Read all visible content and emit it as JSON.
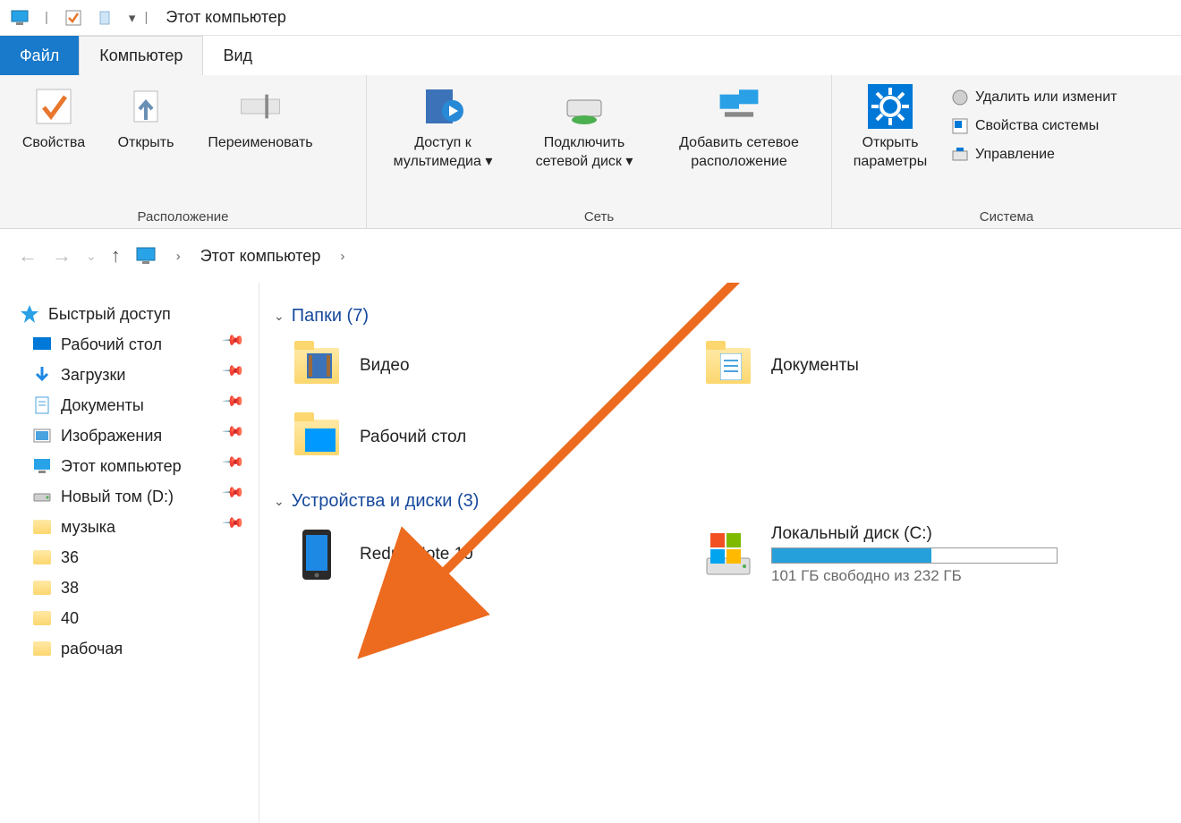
{
  "titlebar": {
    "title": "Этот компьютер"
  },
  "tabs": {
    "file": "Файл",
    "computer": "Компьютер",
    "view": "Вид"
  },
  "ribbon": {
    "group_location": {
      "label": "Расположение",
      "properties": "Свойства",
      "open": "Открыть",
      "rename": "Переименовать"
    },
    "group_network": {
      "label": "Сеть",
      "media_access": "Доступ к мультимедиа ▾",
      "map_drive": "Подключить сетевой диск ▾",
      "add_location": "Добавить сетевое расположение"
    },
    "group_system": {
      "label": "Система",
      "open_settings": "Открыть параметры",
      "uninstall": "Удалить или изменит",
      "sys_props": "Свойства системы",
      "manage": "Управление"
    }
  },
  "breadcrumb": {
    "segment": "Этот компьютер"
  },
  "sidebar": {
    "quick_access": "Быстрый доступ",
    "items": [
      {
        "label": "Рабочий стол",
        "icon": "desktop"
      },
      {
        "label": "Загрузки",
        "icon": "downloads"
      },
      {
        "label": "Документы",
        "icon": "documents"
      },
      {
        "label": "Изображения",
        "icon": "pictures"
      },
      {
        "label": "Этот компьютер",
        "icon": "this-pc"
      },
      {
        "label": "Новый том (D:)",
        "icon": "drive"
      },
      {
        "label": "музыка",
        "icon": "folder"
      },
      {
        "label": "36",
        "icon": "folder"
      },
      {
        "label": "38",
        "icon": "folder"
      },
      {
        "label": "40",
        "icon": "folder"
      },
      {
        "label": "рабочая",
        "icon": "folder"
      }
    ]
  },
  "content": {
    "folders_header": "Папки (7)",
    "devices_header": "Устройства и диски (3)",
    "folders": [
      {
        "label": "Видео"
      },
      {
        "label": "Документы"
      },
      {
        "label": "Рабочий стол"
      }
    ],
    "device_phone": "Redmi Note 10",
    "disk": {
      "label": "Локальный диск (C:)",
      "free_text": "101 ГБ свободно из 232 ГБ",
      "used_percent": 56
    }
  }
}
